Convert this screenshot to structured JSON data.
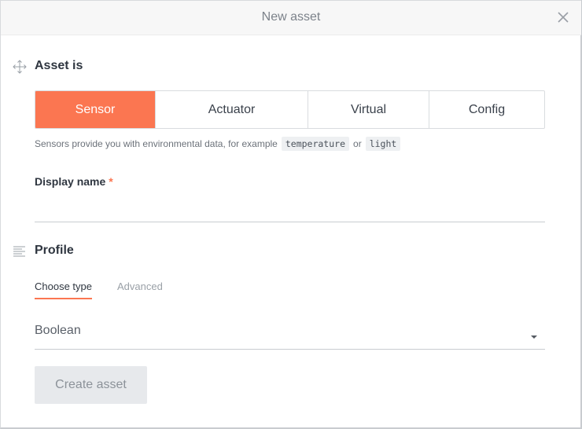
{
  "dialog": {
    "title": "New asset",
    "close_icon": "close-icon"
  },
  "asset_section": {
    "icon": "move-arrows-icon",
    "title": "Asset is",
    "options": [
      {
        "label": "Sensor",
        "selected": true
      },
      {
        "label": "Actuator",
        "selected": false
      },
      {
        "label": "Virtual",
        "selected": false
      },
      {
        "label": "Config",
        "selected": false
      }
    ],
    "hint": {
      "text": "Sensors provide you with environmental data, for example",
      "example_1": "temperature",
      "joiner": "or",
      "example_2": "light"
    }
  },
  "display_name": {
    "label": "Display name",
    "required_mark": "*",
    "value": "",
    "placeholder": ""
  },
  "profile_section": {
    "icon": "lines-list-icon",
    "title": "Profile",
    "tabs": [
      {
        "label": "Choose type",
        "active": true
      },
      {
        "label": "Advanced",
        "active": false
      }
    ],
    "type_select": {
      "value": "Boolean",
      "arrow_icon": "caret-down-icon"
    }
  },
  "actions": {
    "create_label": "Create asset",
    "create_disabled": true
  },
  "colors": {
    "accent": "#fb7651",
    "disabled_button_bg": "#e7e9ec",
    "header_bg": "#f7f7f7"
  }
}
